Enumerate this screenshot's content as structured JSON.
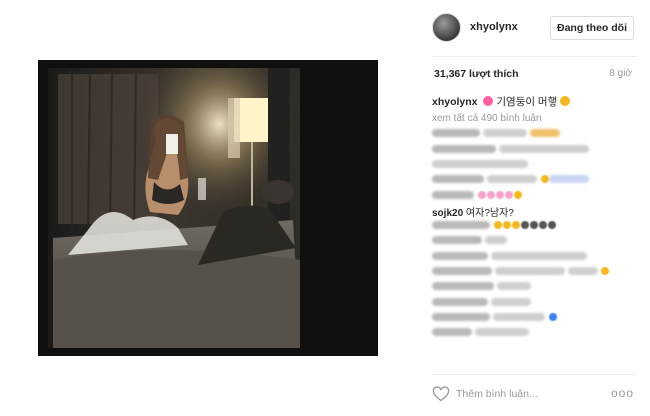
{
  "post": {
    "image_alt": "Selfie in a dark hotel room mirror",
    "username": "xhyolynx",
    "follow_button": "Đang theo dõi",
    "likes": "31,367 lượt thích",
    "time_ago": "8 giờ",
    "caption_text": "기염둥이 머햏",
    "view_all_comments": "xem tất cả 490 bình luận",
    "visible_comment_user": "sojk20",
    "visible_comment_text": "여자?남자?",
    "add_comment_placeholder": "Thêm bình luận...",
    "more_options": "ooo"
  },
  "colors": {
    "text": "#262626",
    "muted": "#999999",
    "border": "#dbdbdb",
    "emoji_yellow": "#f5b81c",
    "emoji_pink": "#ff5fa2",
    "emoji_blue": "#3b82f6"
  }
}
